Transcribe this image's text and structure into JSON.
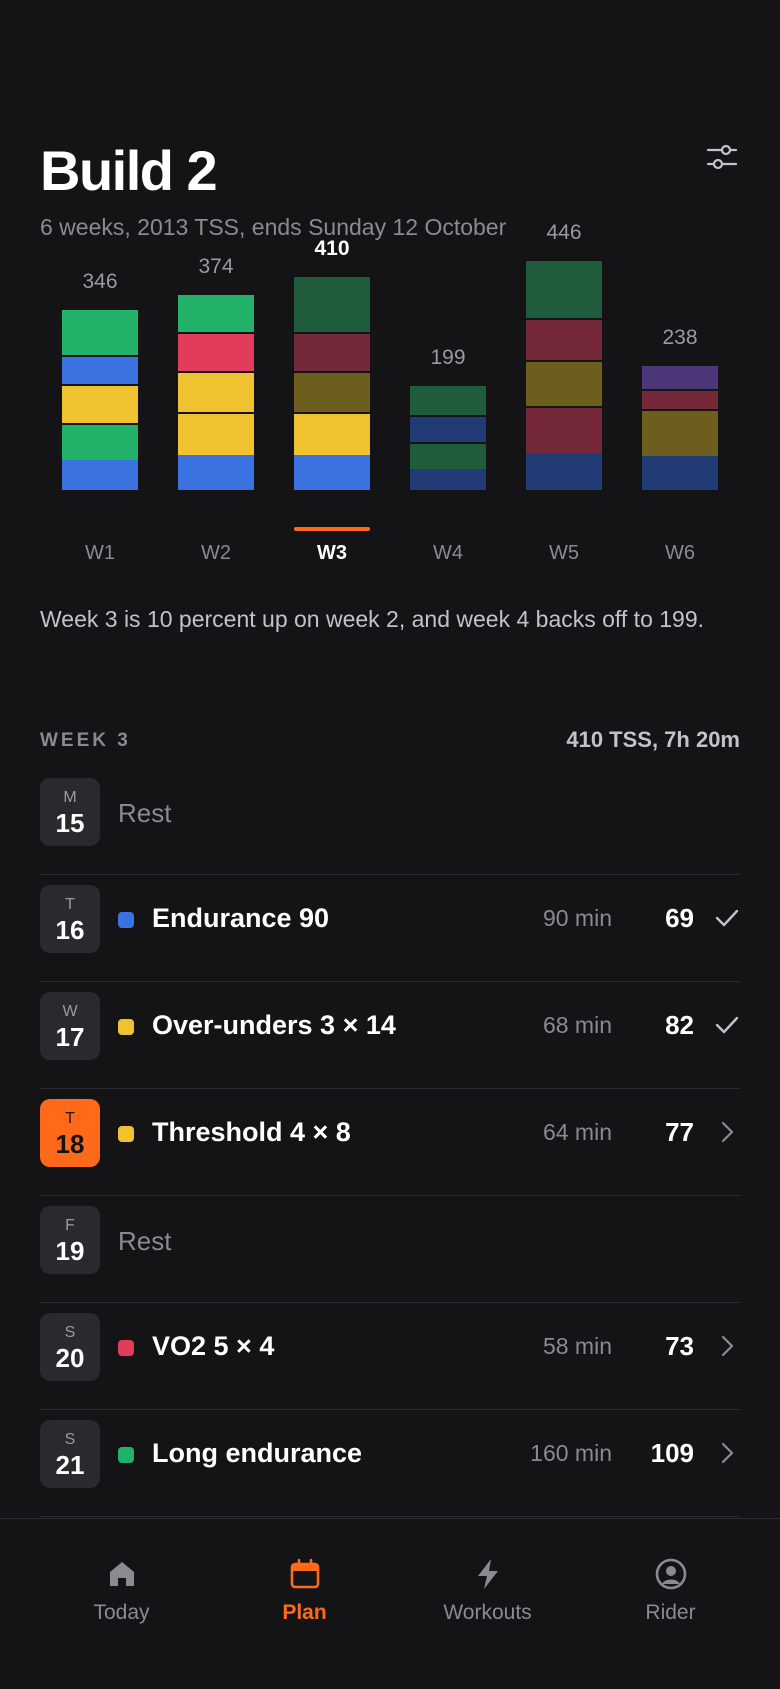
{
  "header": {
    "title": "Build 2",
    "subtitle": "6 weeks, 2013 TSS, ends Sunday 12 October",
    "filter_icon": "sliders-icon"
  },
  "colors": {
    "accent": "#ff6a1a",
    "endurance": "#3a73e0",
    "sweetspot": "#f0c230",
    "vo2": "#e23c5c",
    "long": "#22b26a"
  },
  "chart_data": {
    "type": "bar",
    "categories": [
      "W1",
      "W2",
      "W3",
      "W4",
      "W5",
      "W6"
    ],
    "totals": [
      346,
      374,
      410,
      199,
      446,
      238
    ],
    "selected": "W3",
    "stacks": [
      [
        {
          "color": "#3a73e0",
          "value": 60
        },
        {
          "color": "#22b26a",
          "value": 70
        },
        {
          "color": "#f0c230",
          "value": 73
        },
        {
          "color": "#3a73e0",
          "value": 53
        },
        {
          "color": "#22b26a",
          "value": 90
        }
      ],
      [
        {
          "color": "#3a73e0",
          "value": 69
        },
        {
          "color": "#f0c230",
          "value": 82
        },
        {
          "color": "#f0c230",
          "value": 77
        },
        {
          "color": "#e23c5c",
          "value": 73
        },
        {
          "color": "#22b26a",
          "value": 73
        }
      ],
      [
        {
          "color": "#3a73e0",
          "value": 69
        },
        {
          "color": "#f0c230",
          "value": 82
        },
        {
          "color": "#6e5e1e",
          "value": 77
        },
        {
          "color": "#742838",
          "value": 73
        },
        {
          "color": "#1e5c3c",
          "value": 109
        }
      ],
      [
        {
          "color": "#213b74",
          "value": 42
        },
        {
          "color": "#1e5c3c",
          "value": 50
        },
        {
          "color": "#213b74",
          "value": 50
        },
        {
          "color": "#1e5c3c",
          "value": 57
        }
      ],
      [
        {
          "color": "#213b74",
          "value": 74
        },
        {
          "color": "#742838",
          "value": 90
        },
        {
          "color": "#6e5e1e",
          "value": 88
        },
        {
          "color": "#742838",
          "value": 80
        },
        {
          "color": "#1e5c3c",
          "value": 114
        }
      ],
      [
        {
          "color": "#213b74",
          "value": 67
        },
        {
          "color": "#6e5e1e",
          "value": 90
        },
        {
          "color": "#742838",
          "value": 36
        },
        {
          "color": "#4e3778",
          "value": 45
        }
      ]
    ]
  },
  "summary": "Week 3 is 10 percent up on week 2, and week 4 backs off to 199.",
  "week": {
    "label": "WEEK 3",
    "meta": "410 TSS, 7h 20m",
    "days": [
      {
        "letter": "M",
        "num": "15",
        "rest": "Rest"
      },
      {
        "letter": "T",
        "num": "16",
        "name": "Endurance 90",
        "dur": "90 min",
        "tss": "69",
        "dot": "#3a73e0",
        "status": "check-icon"
      },
      {
        "letter": "W",
        "num": "17",
        "name": "Over-unders 3 × 14",
        "dur": "68 min",
        "tss": "82",
        "dot": "#f0c230",
        "status": "check-icon"
      },
      {
        "letter": "T",
        "num": "18",
        "name": "Threshold 4 × 8",
        "dur": "64 min",
        "tss": "77",
        "dot": "#f0c230",
        "status": "chevron-right-icon",
        "today": true
      },
      {
        "letter": "F",
        "num": "19",
        "rest": "Rest"
      },
      {
        "letter": "S",
        "num": "20",
        "name": "VO2 5 × 4",
        "dur": "58 min",
        "tss": "73",
        "dot": "#e23c5c",
        "status": "chevron-right-icon"
      },
      {
        "letter": "S",
        "num": "21",
        "name": "Long endurance",
        "dur": "160 min",
        "tss": "109",
        "dot": "#22b26a",
        "status": "chevron-right-icon"
      }
    ]
  },
  "tabs": [
    {
      "label": "Today",
      "icon": "home-icon"
    },
    {
      "label": "Plan",
      "icon": "calendar-icon",
      "active": true
    },
    {
      "label": "Workouts",
      "icon": "bolt-icon"
    },
    {
      "label": "Rider",
      "icon": "user-circle-icon"
    }
  ]
}
